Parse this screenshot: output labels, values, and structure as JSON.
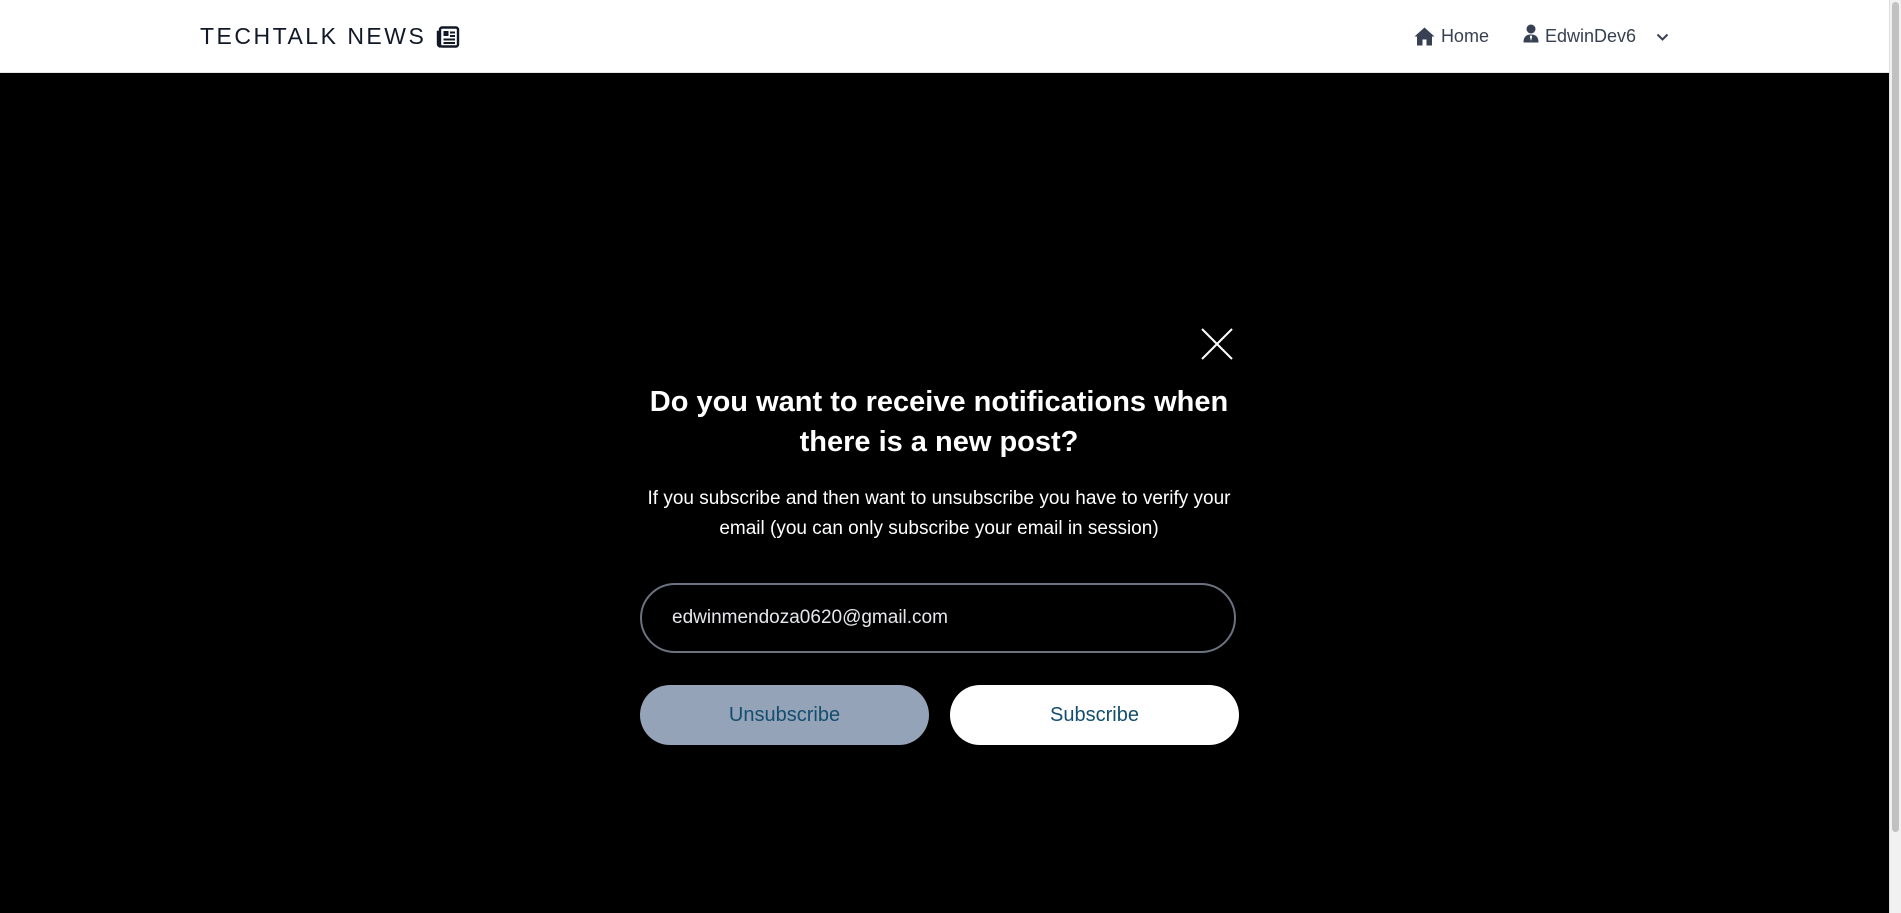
{
  "header": {
    "brand": "TECHTALK NEWS",
    "brand_icon": "newspaper-icon",
    "nav": {
      "home_label": "Home",
      "home_icon": "home-icon",
      "user_label": "EdwinDev6",
      "user_icon": "user-icon",
      "menu_icon": "chevron-down-icon"
    }
  },
  "modal": {
    "close_icon": "close-icon",
    "title": "Do you want to receive notifications when there is a new post?",
    "description": "If you subscribe and then want to unsubscribe you have to verify your email (you can only subscribe your email in session)",
    "email_value": "edwinmendoza0620@gmail.com",
    "unsubscribe_label": "Unsubscribe",
    "subscribe_label": "Subscribe"
  },
  "colors": {
    "overlay": "#000000",
    "unsubscribe_bg": "#94a3b8",
    "subscribe_bg": "#ffffff",
    "button_text": "#134e6f"
  }
}
